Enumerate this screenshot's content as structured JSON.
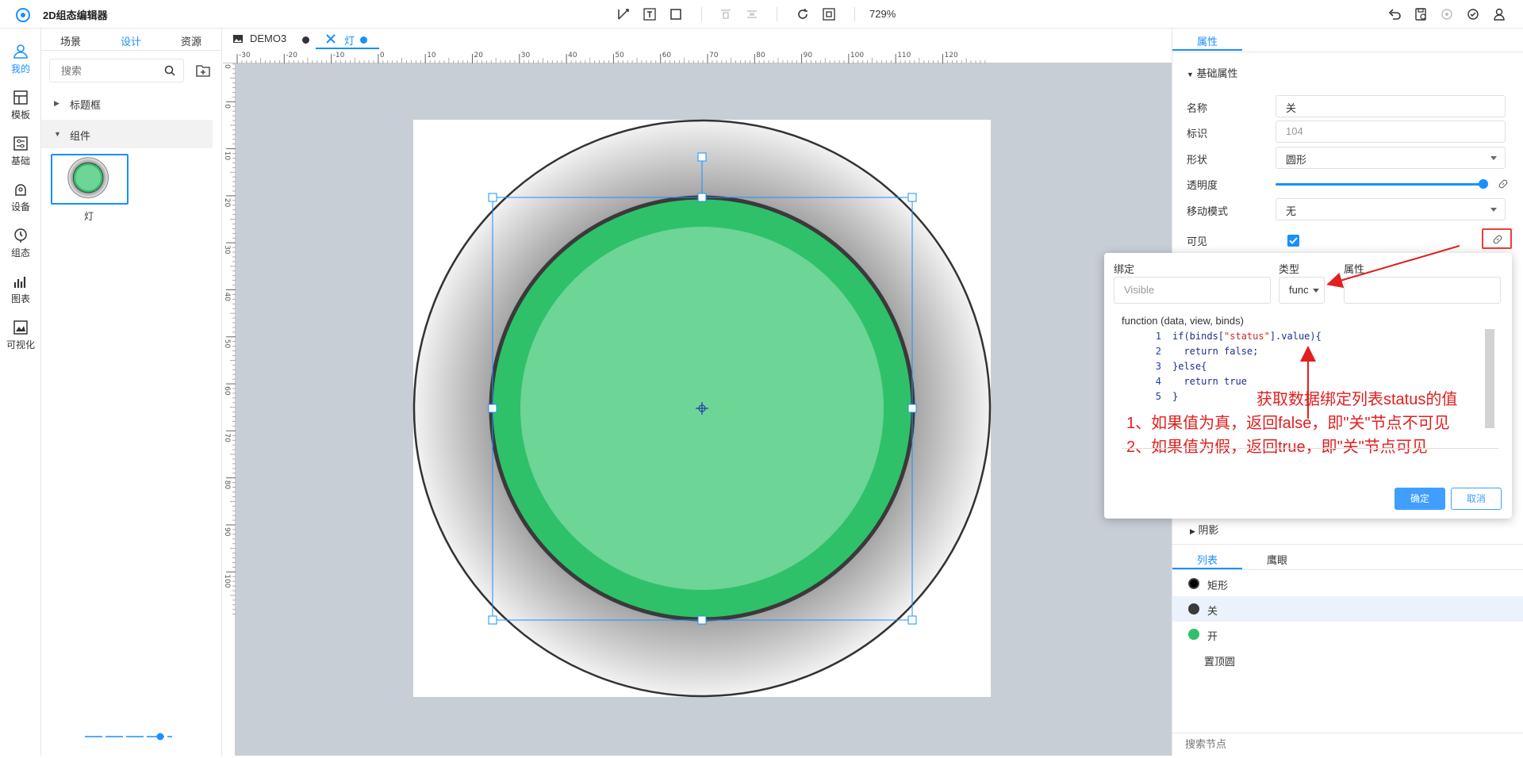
{
  "app": {
    "title": "2D组态编辑器",
    "zoom": "729%"
  },
  "leftnav": [
    {
      "label": "我的",
      "icon": "user-icon"
    },
    {
      "label": "模板",
      "icon": "template-icon"
    },
    {
      "label": "基础",
      "icon": "sliders-icon"
    },
    {
      "label": "设备",
      "icon": "device-icon"
    },
    {
      "label": "组态",
      "icon": "config-icon"
    },
    {
      "label": "图表",
      "icon": "chart-icon"
    },
    {
      "label": "可视化",
      "icon": "visualize-icon"
    }
  ],
  "library": {
    "tabs": [
      "场景",
      "设计",
      "资源"
    ],
    "search_placeholder": "搜索",
    "tree": [
      {
        "label": "标题框",
        "expanded": false
      },
      {
        "label": "组件",
        "expanded": true
      }
    ],
    "component_label": "灯"
  },
  "editor_tabs": [
    {
      "label": "DEMO3",
      "dot_color": "#333333"
    },
    {
      "label": "灯",
      "dot_color": "#1890ff"
    }
  ],
  "rulers": {
    "top": [
      "-30",
      "-20",
      "-10",
      "0",
      "10",
      "20",
      "30",
      "40",
      "50",
      "60",
      "70",
      "80",
      "90",
      "100",
      "110",
      "120"
    ],
    "left": [
      "-10",
      "0",
      "10",
      "20",
      "30",
      "40",
      "50",
      "60",
      "70",
      "80",
      "90",
      "100"
    ]
  },
  "properties": {
    "tabs": [
      "属性"
    ],
    "section_title": "基础属性",
    "name_label": "名称",
    "name_value": "关",
    "id_label": "标识",
    "id_value": "104",
    "shape_label": "形状",
    "shape_value": "圆形",
    "opacity_label": "透明度",
    "opacity_value": 1.0,
    "move_label": "移动模式",
    "move_value": "无",
    "visible_label": "可见",
    "visible_checked": true,
    "shadow_label": "阴影"
  },
  "binding": {
    "bind_label": "绑定",
    "bind_placeholder": "Visible",
    "type_label": "类型",
    "type_value": "func",
    "attr_label": "属性",
    "signature": "function (data, view, binds)",
    "code": [
      {
        "n": "1",
        "text": "if(binds[\"status\"].value){"
      },
      {
        "n": "2",
        "text": "  return false;"
      },
      {
        "n": "3",
        "text": "}else{"
      },
      {
        "n": "4",
        "text": "  return true"
      },
      {
        "n": "5",
        "text": "}"
      }
    ],
    "annotations": [
      "获取数据绑定列表status的值",
      "1、如果值为真，返回false，即\"关\"节点不可见",
      "2、如果值为假，返回true，即\"关\"节点可见"
    ],
    "ok_label": "确定",
    "cancel_label": "取消"
  },
  "nodes": {
    "tabs": [
      "列表",
      "鹰眼"
    ],
    "items": [
      {
        "label": "矩形",
        "color": "#222222"
      },
      {
        "label": "关",
        "color": "#3a3a3a"
      },
      {
        "label": "开",
        "color": "#2ec16a"
      },
      {
        "label": "置顶圆",
        "color": ""
      }
    ],
    "search_placeholder": "搜索节点"
  },
  "colors": {
    "accent": "#1890ff",
    "lamp_green": "#2ec16a",
    "lamp_light": "#6dd596",
    "annotation": "#e02020"
  }
}
